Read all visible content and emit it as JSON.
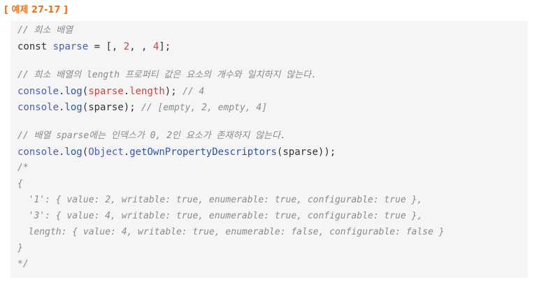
{
  "example_title": "[ 예제 27-17 ]",
  "code": {
    "l1_comment": "// 희소 배열",
    "l2": {
      "kw": "const",
      "name": "sparse",
      "op": " = [, ",
      "n2": "2",
      "mid": ", , ",
      "n4": "4",
      "end": "];"
    },
    "l3_comment": "// 희소 배열의 length 프로퍼티 값은 요소의 개수와 일치하지 않는다.",
    "l4": {
      "console": "console",
      "dot1": ".",
      "log": "log",
      "open": "(",
      "arg_obj": "sparse",
      "dot2": ".",
      "arg_prop": "length",
      "close": "); ",
      "comment": "// 4"
    },
    "l5": {
      "console": "console",
      "dot1": ".",
      "log": "log",
      "open": "(",
      "arg": "sparse",
      "close": "); ",
      "comment": "// [empty, 2, empty, 4]"
    },
    "l6_comment": "// 배열 sparse에는 인덱스가 0, 2인 요소가 존재하지 않는다.",
    "l7": {
      "console": "console",
      "dot1": ".",
      "log": "log",
      "open": "(",
      "obj": "Object",
      "dot2": ".",
      "method": "getOwnPropertyDescriptors",
      "args": "(sparse));"
    },
    "block_comment": [
      "/*",
      "{",
      "  '1': { value: 2, writable: true, enumerable: true, configurable: true },",
      "  '3': { value: 4, writable: true, enumerable: true, configurable: true },",
      "  length: { value: 4, writable: true, enumerable: false, configurable: false }",
      "}",
      "*/"
    ]
  }
}
